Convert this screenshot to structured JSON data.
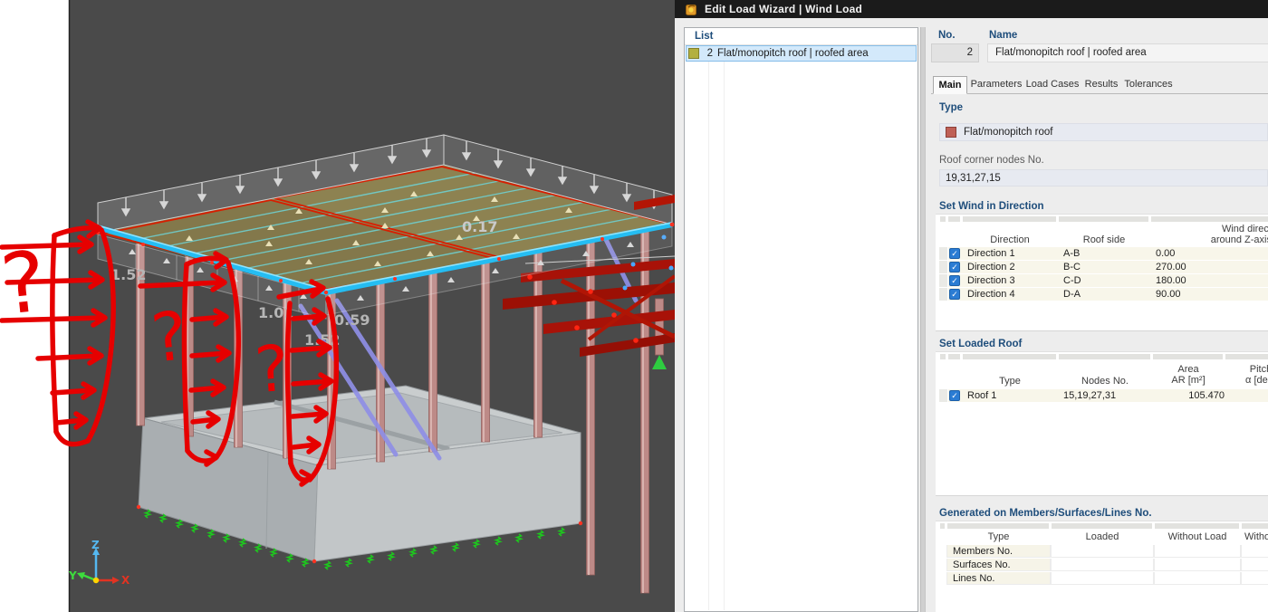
{
  "window": {
    "title": "Edit Load Wizard | Wind Load"
  },
  "viewport": {
    "axis": {
      "x": "X",
      "y": "Y",
      "z": "Z"
    },
    "value_labels": {
      "v1": "1.52",
      "v2": "1.01",
      "v3": "0.59",
      "v4": "1.52",
      "v5": "0.17"
    },
    "annotations": {
      "q1": "?",
      "q2": "?",
      "q3": "?"
    },
    "colors": {
      "background": "#4a4a4a",
      "roof": "#8d8251",
      "edge_highlight": "#25bdf2",
      "columns": "#bd8a87",
      "supports": "#1dc91d",
      "markup": "#e60000"
    }
  },
  "dialog": {
    "list": {
      "header": "List",
      "item": {
        "no": "2",
        "label": "Flat/monopitch roof | roofed area"
      },
      "swatch_color": "#b3b040"
    },
    "no": {
      "label": "No.",
      "value": "2"
    },
    "name": {
      "label": "Name",
      "value": "Flat/monopitch roof | roofed area"
    },
    "tabs": {
      "main": "Main",
      "parameters": "Parameters",
      "load_cases": "Load Cases",
      "results": "Results",
      "tolerances": "Tolerances"
    },
    "type": {
      "label": "Type",
      "value": "Flat/monopitch roof",
      "swatch_color": "#bf6057"
    },
    "roof_nodes": {
      "label": "Roof corner nodes No.",
      "value": "19,31,27,15"
    },
    "wind": {
      "title": "Set Wind in Direction",
      "col_direction": "Direction",
      "col_roof_side": "Roof side",
      "col_wind_dir_line1": "Wind direct",
      "col_wind_dir_line2": "around Z-axis",
      "rows": [
        {
          "checked": true,
          "direction": "Direction 1",
          "roof_side": "A-B",
          "angle": "0.00"
        },
        {
          "checked": true,
          "direction": "Direction 2",
          "roof_side": "B-C",
          "angle": "270.00"
        },
        {
          "checked": true,
          "direction": "Direction 3",
          "roof_side": "C-D",
          "angle": "180.00"
        },
        {
          "checked": true,
          "direction": "Direction 4",
          "roof_side": "D-A",
          "angle": "90.00"
        }
      ]
    },
    "loaded_roof": {
      "title": "Set Loaded Roof",
      "col_type": "Type",
      "col_nodes": "Nodes No.",
      "col_area_line1": "Area",
      "col_area_line2": "AR [m²]",
      "col_pitch_line1": "Pitch",
      "col_pitch_line2": "α [deg]",
      "rows": [
        {
          "checked": true,
          "type": "Roof 1",
          "nodes": "15,19,27,31",
          "area": "105.470",
          "pitch": ""
        }
      ]
    },
    "generated": {
      "title": "Generated on Members/Surfaces/Lines No.",
      "col_type": "Type",
      "col_loaded": "Loaded",
      "col_without_load": "Without Load",
      "col_without_load2": "Witho",
      "rows": [
        {
          "type": "Members No.",
          "loaded": "",
          "without_load": "",
          "extra": ""
        },
        {
          "type": "Surfaces No.",
          "loaded": "",
          "without_load": "",
          "extra": ""
        },
        {
          "type": "Lines No.",
          "loaded": "",
          "without_load": "",
          "extra": ""
        }
      ]
    }
  }
}
